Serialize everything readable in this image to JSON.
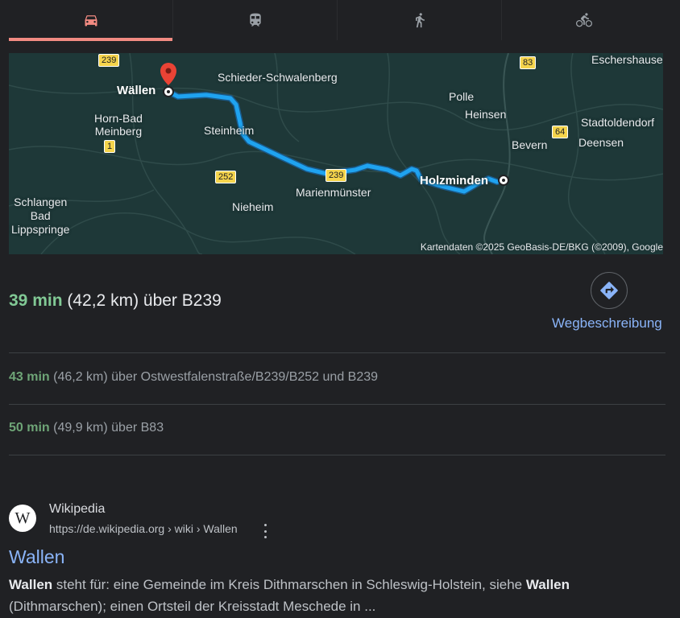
{
  "tabs": [
    {
      "name": "car-icon",
      "active": true
    },
    {
      "name": "train-icon",
      "active": false
    },
    {
      "name": "walk-icon",
      "active": false
    },
    {
      "name": "bike-icon",
      "active": false
    }
  ],
  "colors": {
    "accent": "#f28b82",
    "link": "#8ab4f8",
    "time_green": "#81c995",
    "route": "#1fa3f0"
  },
  "map": {
    "labels": {
      "wallen": "Wällen",
      "schieder": "Schieder-Schwalenberg",
      "eschershausen": "Eschershause",
      "polle": "Polle",
      "heinsen": "Heinsen",
      "horn": "Horn-Bad\nMeinberg",
      "steinheim": "Steinheim",
      "stadtoldendorf": "Stadtoldendorf",
      "deensen": "Deensen",
      "bevern": "Bevern",
      "holzminden": "Holzminden",
      "marienmuenster": "Marienmünster",
      "schlangen": "Schlangen\nBad\nLippspringe",
      "nieheim": "Nieheim"
    },
    "shields": {
      "s239a": "239",
      "s83": "83",
      "s64": "64",
      "s1": "1",
      "s252": "252",
      "s239b": "239"
    },
    "attribution": "Kartendaten ©2025 GeoBasis-DE/BKG (©2009), Google"
  },
  "main_route": {
    "time": "39 min",
    "details": "(42,2 km) über B239"
  },
  "directions_label": "Wegbeschreibung",
  "alt_routes": [
    {
      "time": "43 min",
      "details": "(46,2 km) über Ostwestfalenstraße/B239/B252 und B239"
    },
    {
      "time": "50 min",
      "details": "(49,9 km) über B83"
    }
  ],
  "result": {
    "site_name": "Wikipedia",
    "url": "https://de.wikipedia.org › wiki › Wallen",
    "favicon_letter": "W",
    "title": "Wallen",
    "snippet": {
      "b1": "Wallen",
      "t1": " steht für: eine Gemeinde im Kreis Dithmarschen in Schleswig-Holstein, siehe ",
      "b2": "Wallen",
      "t2": " (Dithmarschen); einen Ortsteil der Kreisstadt Meschede in ..."
    }
  }
}
